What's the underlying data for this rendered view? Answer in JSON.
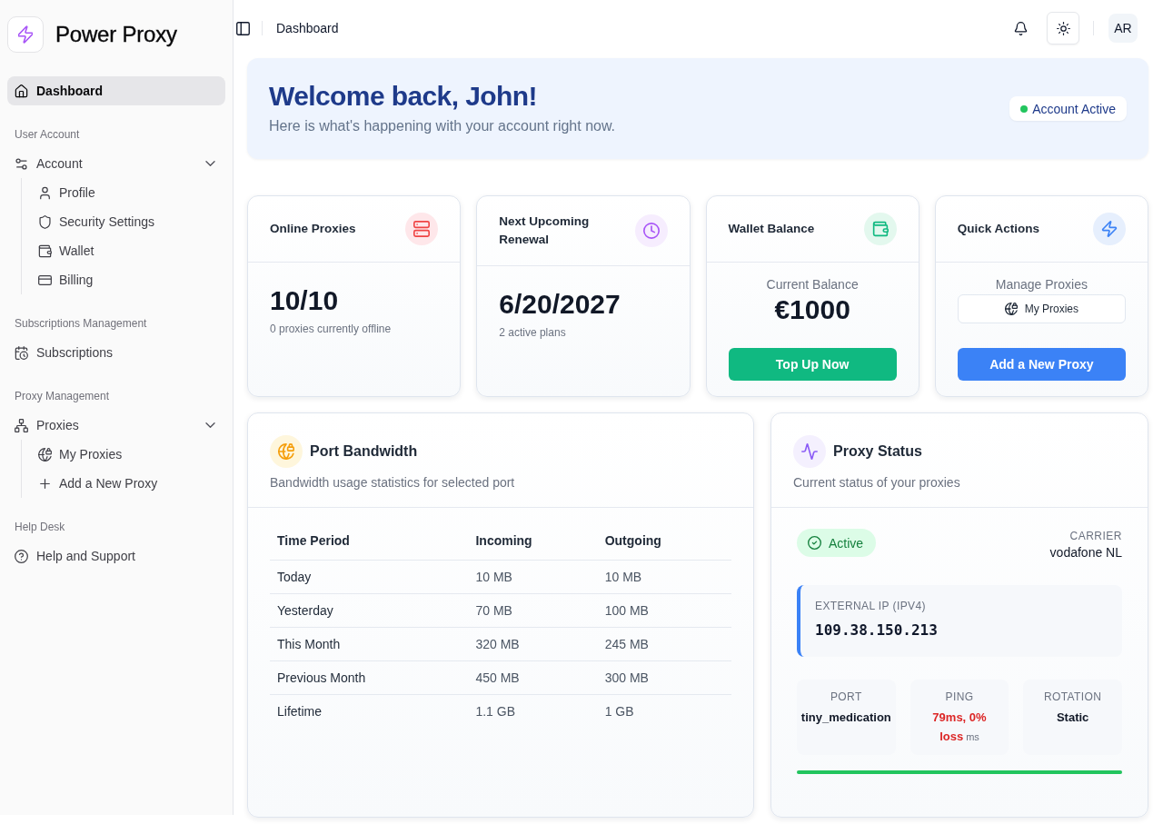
{
  "sidebar": {
    "brand": "Power Proxy",
    "nav": [
      {
        "items": [
          {
            "label": "Dashboard",
            "selected": true
          }
        ]
      },
      {
        "heading": "User Account",
        "items": [
          {
            "label": "Account",
            "selected": false,
            "expanded": true,
            "children": [
              {
                "label": "Profile",
                "selected": false
              },
              {
                "label": "Security Settings",
                "selected": false
              },
              {
                "label": "Wallet",
                "selected": false
              },
              {
                "label": "Billing",
                "selected": false
              }
            ]
          }
        ]
      },
      {
        "heading": "Subscriptions Management",
        "items": [
          {
            "label": "Subscriptions",
            "selected": false
          }
        ]
      },
      {
        "heading": "Proxy Management",
        "items": [
          {
            "label": "Proxies",
            "selected": false,
            "expanded": true,
            "children": [
              {
                "label": "My Proxies",
                "selected": false
              },
              {
                "label": "Add a New Proxy",
                "selected": false
              }
            ]
          }
        ]
      },
      {
        "heading": "Help Desk",
        "items": [
          {
            "label": "Help and Support",
            "selected": false
          }
        ]
      }
    ]
  },
  "topbar": {
    "breadcrumb": "Dashboard",
    "avatar": "AR"
  },
  "welcome": {
    "title": "Welcome back, John!",
    "subtitle": "Here is what's happening with your account right now.",
    "badge": {
      "label": "Account Active",
      "active": true
    }
  },
  "stat_cards": [
    {
      "kind": "metric",
      "title": "Online Proxies",
      "value": "10/10",
      "note": "0 proxies currently offline"
    },
    {
      "kind": "metric",
      "title": "Next Upcoming Renewal",
      "value": "6/20/2027",
      "note": "2 active plans"
    },
    {
      "kind": "balance",
      "title": "Wallet Balance",
      "label": "Current Balance",
      "value": "€1000",
      "button": "Top Up Now"
    },
    {
      "kind": "actions",
      "title": "Quick Actions",
      "label": "Manage Proxies",
      "link_button": "My Proxies",
      "button": "Add a New Proxy"
    }
  ],
  "bandwidth": {
    "title": "Port Bandwidth",
    "subtitle": "Bandwidth usage statistics for selected port",
    "table": {
      "columns": [
        "Time Period",
        "Incoming",
        "Outgoing"
      ],
      "rows": [
        [
          "Today",
          "10 MB",
          "10 MB"
        ],
        [
          "Yesterday",
          "70 MB",
          "100 MB"
        ],
        [
          "This Month",
          "320 MB",
          "245 MB"
        ],
        [
          "Previous Month",
          "450 MB",
          "300 MB"
        ],
        [
          "Lifetime",
          "1.1 GB",
          "1 GB"
        ]
      ]
    }
  },
  "proxy_status": {
    "title": "Proxy Status",
    "subtitle": "Current status of your proxies",
    "status": {
      "label": "Active",
      "active": true
    },
    "carrier": {
      "label": "CARRIER",
      "value": "vodafone NL"
    },
    "external_ip": {
      "label": "EXTERNAL IP (IPV4)",
      "value": "109.38.150.213"
    },
    "stats": [
      {
        "kind": "plain",
        "label": "PORT",
        "value": "tiny_medication"
      },
      {
        "kind": "alert",
        "label": "PING",
        "value": "79ms, 0% loss",
        "unit": "ms"
      },
      {
        "kind": "plain",
        "label": "ROTATION",
        "value": "Static"
      }
    ],
    "health": {
      "level": 1
    }
  }
}
